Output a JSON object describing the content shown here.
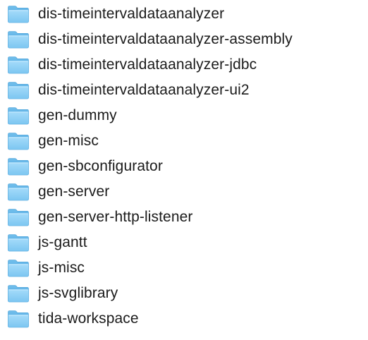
{
  "finder": {
    "folder_icon": "folder-icon",
    "folder_color": "#7cc6f1",
    "items": [
      {
        "name": "dis-timeintervaldataanalyzer"
      },
      {
        "name": "dis-timeintervaldataanalyzer-assembly"
      },
      {
        "name": "dis-timeintervaldataanalyzer-jdbc"
      },
      {
        "name": "dis-timeintervaldataanalyzer-ui2"
      },
      {
        "name": "gen-dummy"
      },
      {
        "name": "gen-misc"
      },
      {
        "name": "gen-sbconfigurator"
      },
      {
        "name": "gen-server"
      },
      {
        "name": "gen-server-http-listener"
      },
      {
        "name": "js-gantt"
      },
      {
        "name": "js-misc"
      },
      {
        "name": "js-svglibrary"
      },
      {
        "name": "tida-workspace"
      }
    ]
  }
}
